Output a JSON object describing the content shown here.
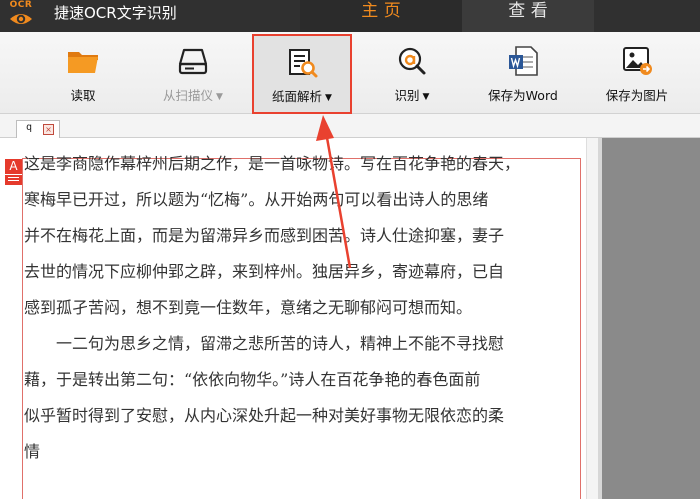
{
  "app": {
    "logo_text": "OCR",
    "title": "捷速OCR文字识别"
  },
  "main_tabs": [
    {
      "label": "主 页",
      "active": true
    },
    {
      "label": "查 看",
      "active": false
    }
  ],
  "toolbar": {
    "read_label": "读取",
    "scan_label": "从扫描仪",
    "parse_label": "纸面解析",
    "recognize_label": "识别",
    "save_word_label": "保存为Word",
    "save_picture_label": "保存为图片",
    "dropdown_glyph": "▼"
  },
  "doc_tab": {
    "name": "q",
    "close_glyph": "×"
  },
  "region": {
    "letter": "A"
  },
  "document_lines": [
    "这是李商隐作幕梓州后期之作，是一首咏物诗。写在百花争艳的春天，",
    "寒梅早已开过，所以题为“忆梅”。从开始两句可以看出诗人的思绪",
    "并不在梅花上面，而是为留滞异乡而感到困苦。诗人仕途抑塞，妻子",
    "去世的情况下应柳仲郢之辟，来到梓州。独居异乡，寄迹幕府，已自",
    "感到孤孑苦闷，想不到竟一住数年，意绪之无聊郁闷可想而知。",
    "一二句为思乡之情，留滞之悲所苦的诗人，精神上不能不寻找慰",
    "藉，于是转出第二句：“依依向物华。”诗人在百花争艳的春色面前",
    "似乎暂时得到了安慰，从内心深处升起一种对美好事物无限依恋的柔",
    "情"
  ],
  "colors": {
    "accent": "#f08a1e",
    "highlight_border": "#e9412f",
    "titlebar_bg": "#303030"
  }
}
